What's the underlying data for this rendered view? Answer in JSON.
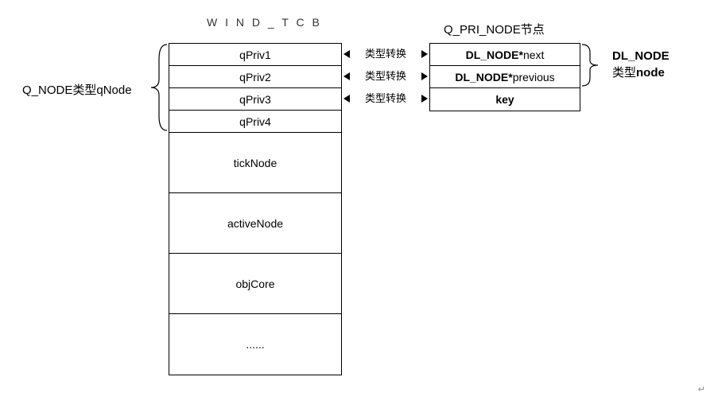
{
  "titles": {
    "wind_tcb": "W I N D _ T C B",
    "qpri_node": "Q_PRI_NODE节点"
  },
  "tcb": {
    "rows": [
      "qPriv1",
      "qPriv2",
      "qPriv3",
      "qPriv4",
      "tickNode",
      "activeNode",
      "objCore",
      "......"
    ]
  },
  "qpri": {
    "rows": [
      {
        "bold": "DL_NODE*",
        "light": "next"
      },
      {
        "bold": "DL_NODE*",
        "light": "previous"
      },
      {
        "bold": "key",
        "light": ""
      }
    ]
  },
  "conv_label": "类型转换",
  "labels": {
    "qnode": "Q_NODE类型qNode",
    "dlnode_line1": "DL_NODE",
    "dlnode_line2a": "类型",
    "dlnode_line2b": "node"
  },
  "ret_symbol": "↵"
}
